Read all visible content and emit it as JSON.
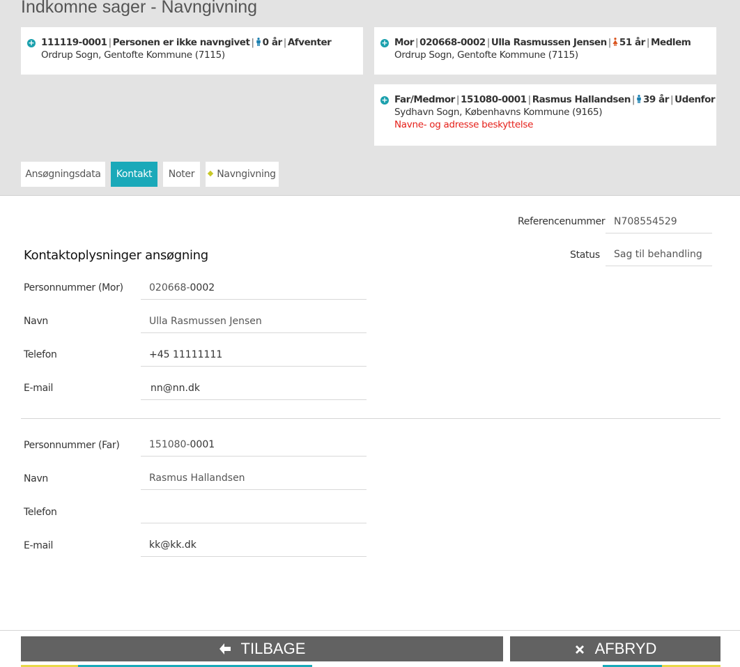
{
  "page": {
    "title": "Indkomne sager - Navngivning"
  },
  "cards": [
    {
      "id": "111119-0001",
      "status_text": "Personen er ikke navngivet",
      "age": "0 år",
      "state": "Afventer",
      "parish": "Ordrup Sogn, Gentofte Kommune (7115)"
    },
    {
      "role": "Mor",
      "id": "020668-0002",
      "name": "Ulla Rasmussen Jensen",
      "age": "51 år",
      "state": "Medlem",
      "parish": "Ordrup Sogn, Gentofte Kommune (7115)"
    },
    {
      "role": "Far/Medmor",
      "id": "151080-0001",
      "name": "Rasmus Hallandsen",
      "age": "39 år",
      "state": "Udenfor",
      "parish": "Sydhavn Sogn, Københavns Kommune (9165)",
      "warning": "Navne- og adresse beskyttelse"
    }
  ],
  "tabs": [
    {
      "label": "Ansøgningsdata"
    },
    {
      "label": "Kontakt"
    },
    {
      "label": "Noter"
    },
    {
      "label": "Navngivning"
    }
  ],
  "meta": {
    "reference_label": "Referencenummer",
    "reference_value": "N708554529",
    "status_label": "Status",
    "status_value": "Sag til behandling"
  },
  "section": {
    "title": "Kontaktoplysninger ansøgning"
  },
  "mother": {
    "cpr_label": "Personnummer (Mor)",
    "cpr_date": "020668-",
    "cpr_seq": "0002",
    "name_label": "Navn",
    "name_value": "Ulla Rasmussen Jensen",
    "phone_label": "Telefon",
    "phone_value": "+45 11111111",
    "email_label": "E-mail",
    "email_value": "nn@nn.dk"
  },
  "father": {
    "cpr_label": "Personnummer (Far)",
    "cpr_date": "151080-",
    "cpr_seq": "0001",
    "name_label": "Navn",
    "name_value": "Rasmus Hallandsen",
    "phone_label": "Telefon",
    "phone_value": "",
    "email_label": "E-mail",
    "email_value": "kk@kk.dk"
  },
  "buttons": {
    "back": "TILBAGE",
    "cancel": "AFBRYD"
  },
  "icons": {
    "plus": "plus-circle-icon",
    "male": "male-person-icon",
    "female": "female-person-icon",
    "back": "arrow-left-icon",
    "cancel": "close-icon"
  },
  "colors": {
    "accent": "#1aa9b9",
    "warning": "#e5201a",
    "female": "#d9541e",
    "male": "#1a7fb0",
    "button": "#626262"
  }
}
